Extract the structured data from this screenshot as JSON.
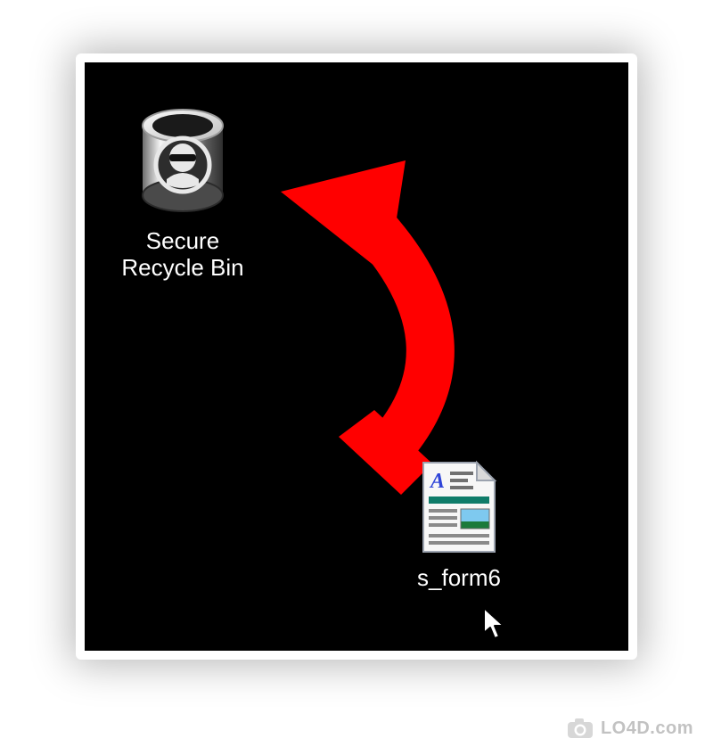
{
  "desktop": {
    "icons": [
      {
        "label": "Secure\nRecycle Bin",
        "name": "secure-recycle-bin-icon"
      },
      {
        "label": "s_form6",
        "name": "document-file-icon"
      }
    ]
  },
  "colors": {
    "arrow": "#ff0000",
    "background": "#000000",
    "label": "#ffffff"
  },
  "watermark": {
    "text": "LO4D.com"
  }
}
